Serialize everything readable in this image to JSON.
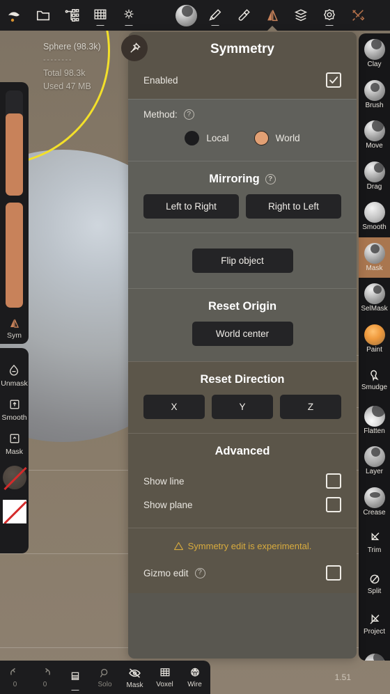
{
  "app": {
    "version": "1.51"
  },
  "topbar": {
    "items": [
      {
        "name": "sculpt-logo-icon",
        "label": ""
      },
      {
        "name": "folder-icon",
        "label": ""
      },
      {
        "name": "scene-graph-icon",
        "label": ""
      },
      {
        "name": "grid-icon",
        "label": ""
      },
      {
        "name": "light-icon",
        "label": ""
      },
      {
        "name": "material-sphere-icon",
        "label": ""
      },
      {
        "name": "brush-icon",
        "label": ""
      },
      {
        "name": "paint-bucket-icon",
        "label": ""
      },
      {
        "name": "symmetry-icon",
        "label": ""
      },
      {
        "name": "layers-icon",
        "label": ""
      },
      {
        "name": "settings-gear-icon",
        "label": ""
      },
      {
        "name": "tools-icon",
        "label": ""
      }
    ]
  },
  "stats": {
    "object": "Sphere (98.3k)",
    "divider": "--------",
    "total": "Total 98.3k",
    "used": "Used 47 MB"
  },
  "left_rail_top": {
    "slider_top": {
      "name": "radius-slider",
      "value_pct": 78
    },
    "slider_bottom": {
      "name": "intensity-slider",
      "value_pct": 100
    },
    "sym_button": {
      "label": "Sym"
    }
  },
  "left_rail_bottom": {
    "items": [
      {
        "label": "Unmask",
        "icon": "unmask-icon"
      },
      {
        "label": "Smooth",
        "icon": "smooth-icon"
      },
      {
        "label": "Mask",
        "icon": "mask-icon"
      }
    ],
    "swatch_circle": {
      "name": "matcap-swatch",
      "disabled": true
    },
    "swatch_square": {
      "name": "color-swatch",
      "disabled": true
    }
  },
  "right_rail": {
    "tools": [
      {
        "label": "Clay",
        "active": false
      },
      {
        "label": "Brush",
        "active": false
      },
      {
        "label": "Move",
        "active": false
      },
      {
        "label": "Drag",
        "active": false
      },
      {
        "label": "Smooth",
        "active": false
      },
      {
        "label": "Mask",
        "active": true
      },
      {
        "label": "SelMask",
        "active": false
      },
      {
        "label": "Paint",
        "active": false
      },
      {
        "label": "Smudge",
        "active": false
      },
      {
        "label": "Flatten",
        "active": false
      },
      {
        "label": "Layer",
        "active": false
      },
      {
        "label": "Crease",
        "active": false
      },
      {
        "label": "Trim",
        "active": false
      },
      {
        "label": "Split",
        "active": false
      },
      {
        "label": "Project",
        "active": false
      },
      {
        "label": "",
        "active": false
      }
    ]
  },
  "panel": {
    "pin_icon": "pin-icon",
    "title": "Symmetry",
    "enabled_row": {
      "label": "Enabled",
      "checked": true
    },
    "method": {
      "label": "Method:",
      "help_icon": "help-icon",
      "options": [
        {
          "label": "Local",
          "selected": false
        },
        {
          "label": "World",
          "selected": true
        }
      ]
    },
    "mirroring": {
      "title": "Mirroring",
      "help_icon": "help-icon",
      "left_to_right": "Left to Right",
      "right_to_left": "Right to Left",
      "flip_object": "Flip object"
    },
    "reset_origin": {
      "title": "Reset Origin",
      "world_center": "World center"
    },
    "reset_direction": {
      "title": "Reset Direction",
      "axes": [
        "X",
        "Y",
        "Z"
      ]
    },
    "advanced": {
      "title": "Advanced",
      "show_line": {
        "label": "Show line",
        "checked": false
      },
      "show_plane": {
        "label": "Show plane",
        "checked": false
      },
      "warning": "Symmetry edit is experimental.",
      "gizmo_edit": {
        "label": "Gizmo edit",
        "checked": false,
        "help_icon": "help-icon"
      }
    }
  },
  "bottombar": {
    "undo": {
      "label": "0",
      "icon": "undo-icon"
    },
    "redo": {
      "label": "0",
      "icon": "redo-icon"
    },
    "layers": {
      "label": "",
      "icon": "layers-stack-icon"
    },
    "solo": {
      "label": "Solo",
      "icon": "solo-icon"
    },
    "mask": {
      "label": "Mask",
      "icon": "mask-eye-off-icon"
    },
    "voxel": {
      "label": "Voxel",
      "icon": "voxel-grid-icon"
    },
    "wire": {
      "label": "Wire",
      "icon": "wireframe-icon"
    }
  },
  "colors": {
    "accent": "#c8825a",
    "panel_bg": "#595750",
    "button_bg": "#242426",
    "warning": "#d8ab3e",
    "sym_curve": "#f3e02a"
  }
}
